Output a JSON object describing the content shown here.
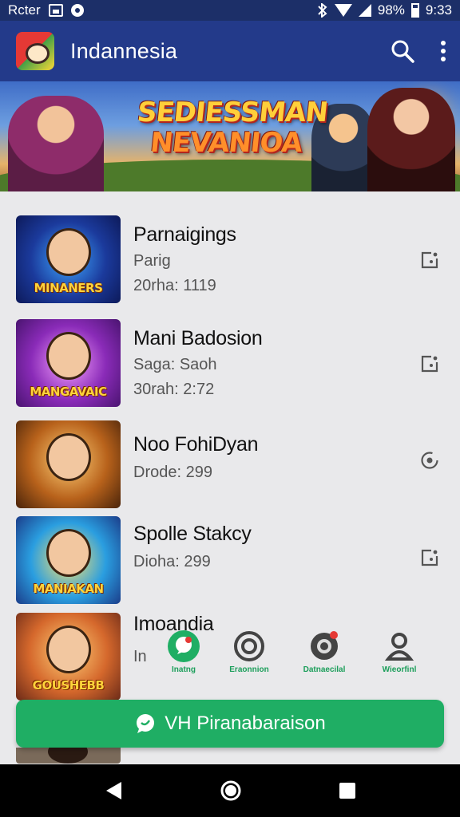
{
  "status_bar": {
    "carrier": "Rcter",
    "battery_text": "98%",
    "time": "9:33"
  },
  "app_bar": {
    "title": "Indannesia",
    "icons": [
      "app-logo",
      "search-icon",
      "more-vert-icon"
    ]
  },
  "banner": {
    "title_line1": "SEDIESSMAN",
    "title_line2": "NEVANIOA"
  },
  "list": [
    {
      "title": "Parnaigings",
      "line1": "Parig",
      "line2": "20rha: 1119",
      "thumb_caption": "MINANERS",
      "action_icon": "share-box-icon"
    },
    {
      "title": "Mani Badosion",
      "line1": "Saga:  Saoh",
      "line2": "30rah: 2:72",
      "thumb_caption": "MANGAVAIC",
      "action_icon": "share-box-icon"
    },
    {
      "title": "Noo FohiDyan",
      "line1": "Drode: 299",
      "line2": "",
      "thumb_caption": "",
      "action_icon": "refresh-circle-icon"
    },
    {
      "title": "Spolle Stakcy",
      "line1": "Dioha: 299",
      "line2": "",
      "thumb_caption": "MANIAKAN",
      "action_icon": "share-box-icon"
    },
    {
      "title": "Imoandia",
      "line1": "In",
      "line2": "",
      "thumb_caption": "GOUSHEBB",
      "action_icon": ""
    }
  ],
  "share_options": [
    {
      "label": "Inatng",
      "icon": "whatsapp-icon"
    },
    {
      "label": "Eraonnion",
      "icon": "target-icon"
    },
    {
      "label": "Datnaecilal",
      "icon": "camera-icon"
    },
    {
      "label": "Wieorfinl",
      "icon": "person-icon"
    }
  ],
  "cta_button": {
    "label": "VH Piranabaraison",
    "icon": "chat-bubble-icon"
  },
  "nav_bar": {
    "icons": [
      "back-icon",
      "home-icon",
      "recents-icon"
    ]
  },
  "colors": {
    "app_bar": "#233a8a",
    "status_bar": "#1c2f68",
    "accent_green": "#1fae64",
    "background": "#e9e9eb"
  }
}
